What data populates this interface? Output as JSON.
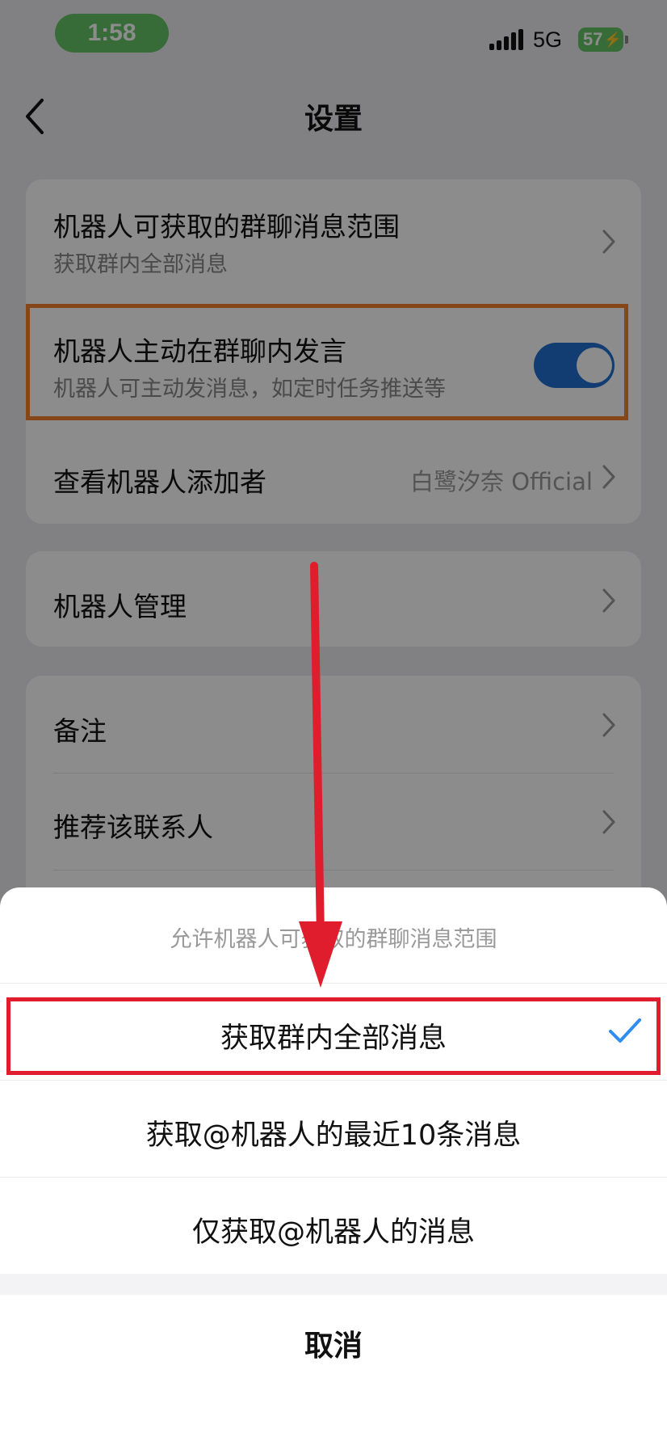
{
  "status_bar": {
    "time": "1:58",
    "network": "5G",
    "battery": "57"
  },
  "nav": {
    "title": "设置"
  },
  "settings": {
    "group1": {
      "range": {
        "title": "机器人可获取的群聊消息范围",
        "subtitle": "获取群内全部消息"
      },
      "proactive": {
        "title": "机器人主动在群聊内发言",
        "subtitle": "机器人可主动发消息，如定时任务推送等",
        "enabled": true
      },
      "adder": {
        "title": "查看机器人添加者",
        "value": "白鹭汐奈 Official"
      }
    },
    "group2": {
      "manage": {
        "title": "机器人管理"
      }
    },
    "group3": {
      "remark": {
        "title": "备注"
      },
      "recommend": {
        "title": "推荐该联系人"
      }
    }
  },
  "sheet": {
    "title": "允许机器人可获取的群聊消息范围",
    "options": [
      {
        "label": "获取群内全部消息",
        "selected": true
      },
      {
        "label": "获取@机器人的最近10条消息",
        "selected": false
      },
      {
        "label": "仅获取@机器人的消息",
        "selected": false
      }
    ],
    "cancel": "取消"
  },
  "colors": {
    "toggle_on": "#1f6fd1",
    "check": "#2f8cf0",
    "highlight_orange": "#f5802a",
    "highlight_red": "#e01d2c",
    "time_pill": "#65c466"
  }
}
